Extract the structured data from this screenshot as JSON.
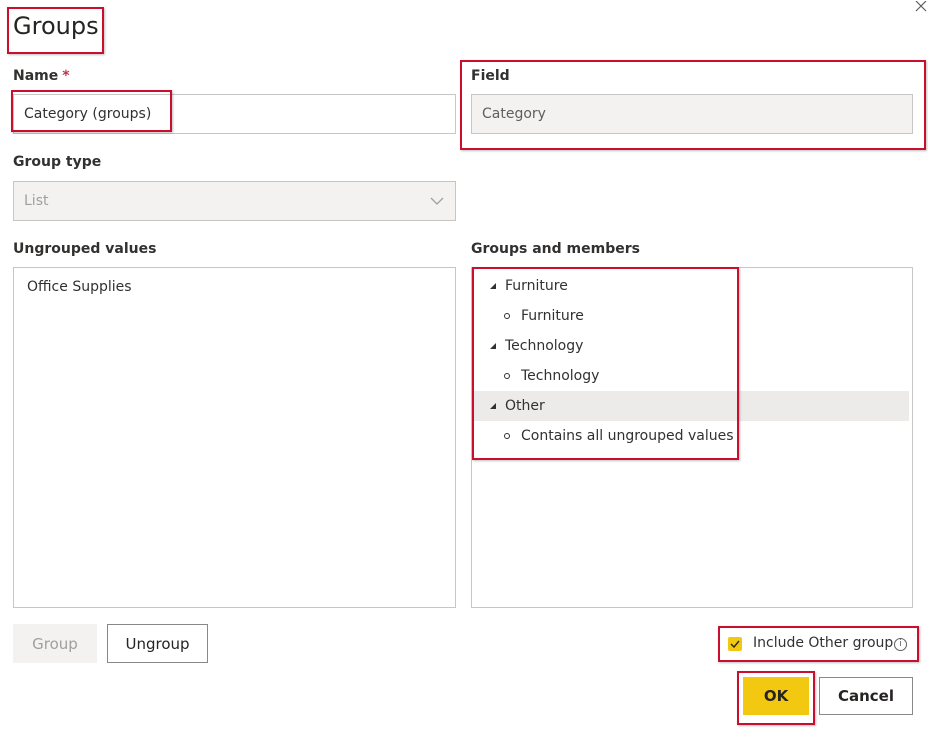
{
  "dialog": {
    "title": "Groups",
    "close_icon": "close-icon"
  },
  "name_field": {
    "label": "Name",
    "required_marker": "*",
    "value": "Category (groups)"
  },
  "field_field": {
    "label": "Field",
    "value": "Category"
  },
  "group_type": {
    "label": "Group type",
    "value": "List",
    "icon": "chevron-down-icon"
  },
  "ungrouped": {
    "label": "Ungrouped values",
    "items": [
      "Office Supplies"
    ]
  },
  "groups": {
    "label": "Groups and members",
    "tree": [
      {
        "group": "Furniture",
        "members": [
          "Furniture"
        ]
      },
      {
        "group": "Technology",
        "members": [
          "Technology"
        ]
      },
      {
        "group": "Other",
        "members": [
          "Contains all ungrouped values"
        ],
        "selected": true
      }
    ]
  },
  "buttons": {
    "group": "Group",
    "ungroup": "Ungroup",
    "ok": "OK",
    "cancel": "Cancel"
  },
  "include_other": {
    "label": "Include Other group",
    "checked": true,
    "info_icon": "i"
  },
  "colors": {
    "accent": "#f2c811",
    "highlight": "#c8102e",
    "selected_row": "#edebe9"
  }
}
